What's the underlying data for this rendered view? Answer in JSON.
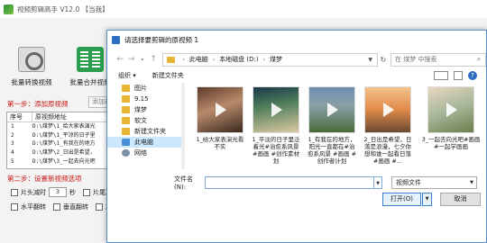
{
  "app": {
    "title": "视频剪辑高手 V12.0  【当我】",
    "tools": [
      {
        "label": "批量转换视频"
      },
      {
        "label": "批量合并视频"
      }
    ],
    "step1_label": "第一步：添加原视频",
    "add_video_button": "添加视",
    "table": {
      "headers": [
        "序号",
        "原视频地址"
      ],
      "rows": [
        {
          "no": "1",
          "path": "D:\\煤梦\\1_给大家表演光"
        },
        {
          "no": "2",
          "path": "D:\\煤梦\\1_平凉的日子里"
        },
        {
          "no": "3",
          "path": "D:\\煤梦\\1_有我在的地方"
        },
        {
          "no": "4",
          "path": "D:\\煤梦\\2_日出是希望，"
        },
        {
          "no": "5",
          "path": "D:\\煤梦\\3_一起去向光吧"
        }
      ]
    },
    "step2_label": "第二步：设置新视频选项",
    "options": {
      "head_cut": "片头减时",
      "head_value": "3",
      "seconds": "秒",
      "tail_cut": "片尾减",
      "hflip": "水平翻转",
      "vflip": "垂直翻转",
      "rotate": "旋转"
    }
  },
  "dialog": {
    "title": "请选择要剪辑的原视频 1",
    "breadcrumb": [
      "此电脑",
      "本地磁盘 (D:)",
      "煤梦"
    ],
    "search_placeholder": "在 煤梦 中搜索",
    "organize": "组织 ▾",
    "new_folder": "新建文件夹",
    "help": "?",
    "nav_items": [
      {
        "label": "图片",
        "icon": "folder"
      },
      {
        "label": "9.15",
        "icon": "folder"
      },
      {
        "label": "煤梦",
        "icon": "folder"
      },
      {
        "label": "软文",
        "icon": "folder"
      },
      {
        "label": "新建文件夹",
        "icon": "folder"
      },
      {
        "label": "此电脑",
        "icon": "pc",
        "selected": true
      },
      {
        "label": "网络",
        "icon": "network"
      }
    ],
    "files": [
      {
        "name": "1_给大家表演光看不实"
      },
      {
        "name": "1_平淡的日子里泛着光#治愈系风景 #画画 #创作素材划"
      },
      {
        "name": "1_有我在的地方，阳光一直都在#治愈系风景 #画画 #创作者计划"
      },
      {
        "name": "2_日出是希望，日落是浪漫，七夕你想和谁一起看日落#画画 #..."
      },
      {
        "name": "3_一起去向光吧#画画 #一起学画画"
      }
    ],
    "filename_label": "文件名(N):",
    "filename_value": "",
    "filetype_value": "视频文件",
    "open_button": "打开(O)",
    "cancel_button": "取消"
  }
}
